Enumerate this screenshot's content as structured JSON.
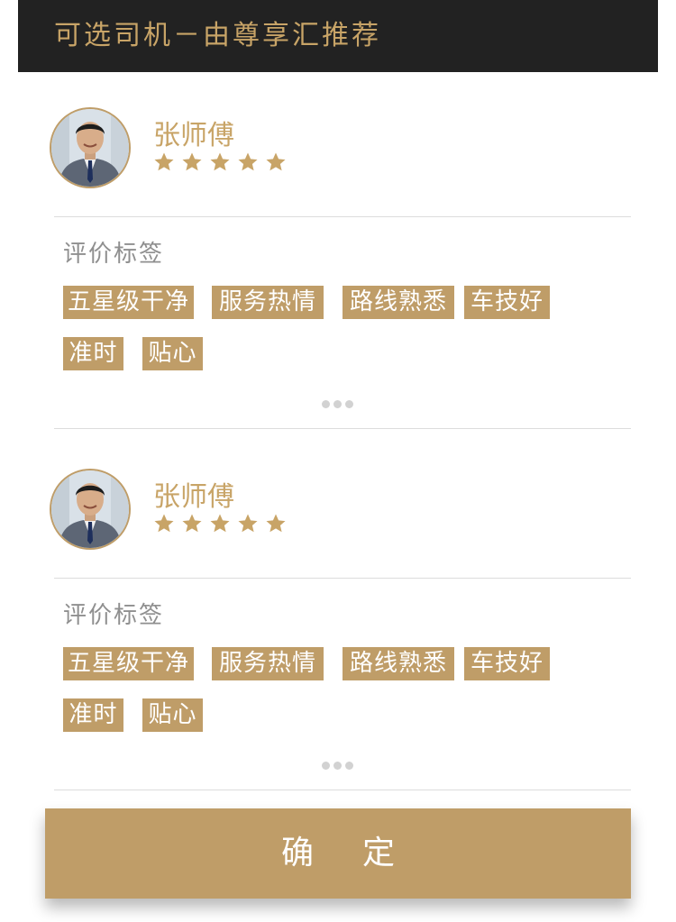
{
  "header": {
    "title": "可选司机－由尊享汇推荐"
  },
  "drivers": [
    {
      "name": "张师傅",
      "rating": 5,
      "tags_title": "评价标签",
      "tags": [
        "五星级干净",
        "服务热情",
        "路线熟悉",
        "车技好",
        "准时",
        "贴心"
      ]
    },
    {
      "name": "张师傅",
      "rating": 5,
      "tags_title": "评价标签",
      "tags": [
        "五星级干净",
        "服务热情",
        "路线熟悉",
        "车技好",
        "准时",
        "贴心"
      ]
    }
  ],
  "icons": {
    "star": "star-icon",
    "more": "more-dots-icon"
  },
  "colors": {
    "accent": "#bf9d68",
    "header_bg": "#222222",
    "header_text": "#c8a467"
  },
  "confirm": {
    "label": "确定"
  }
}
